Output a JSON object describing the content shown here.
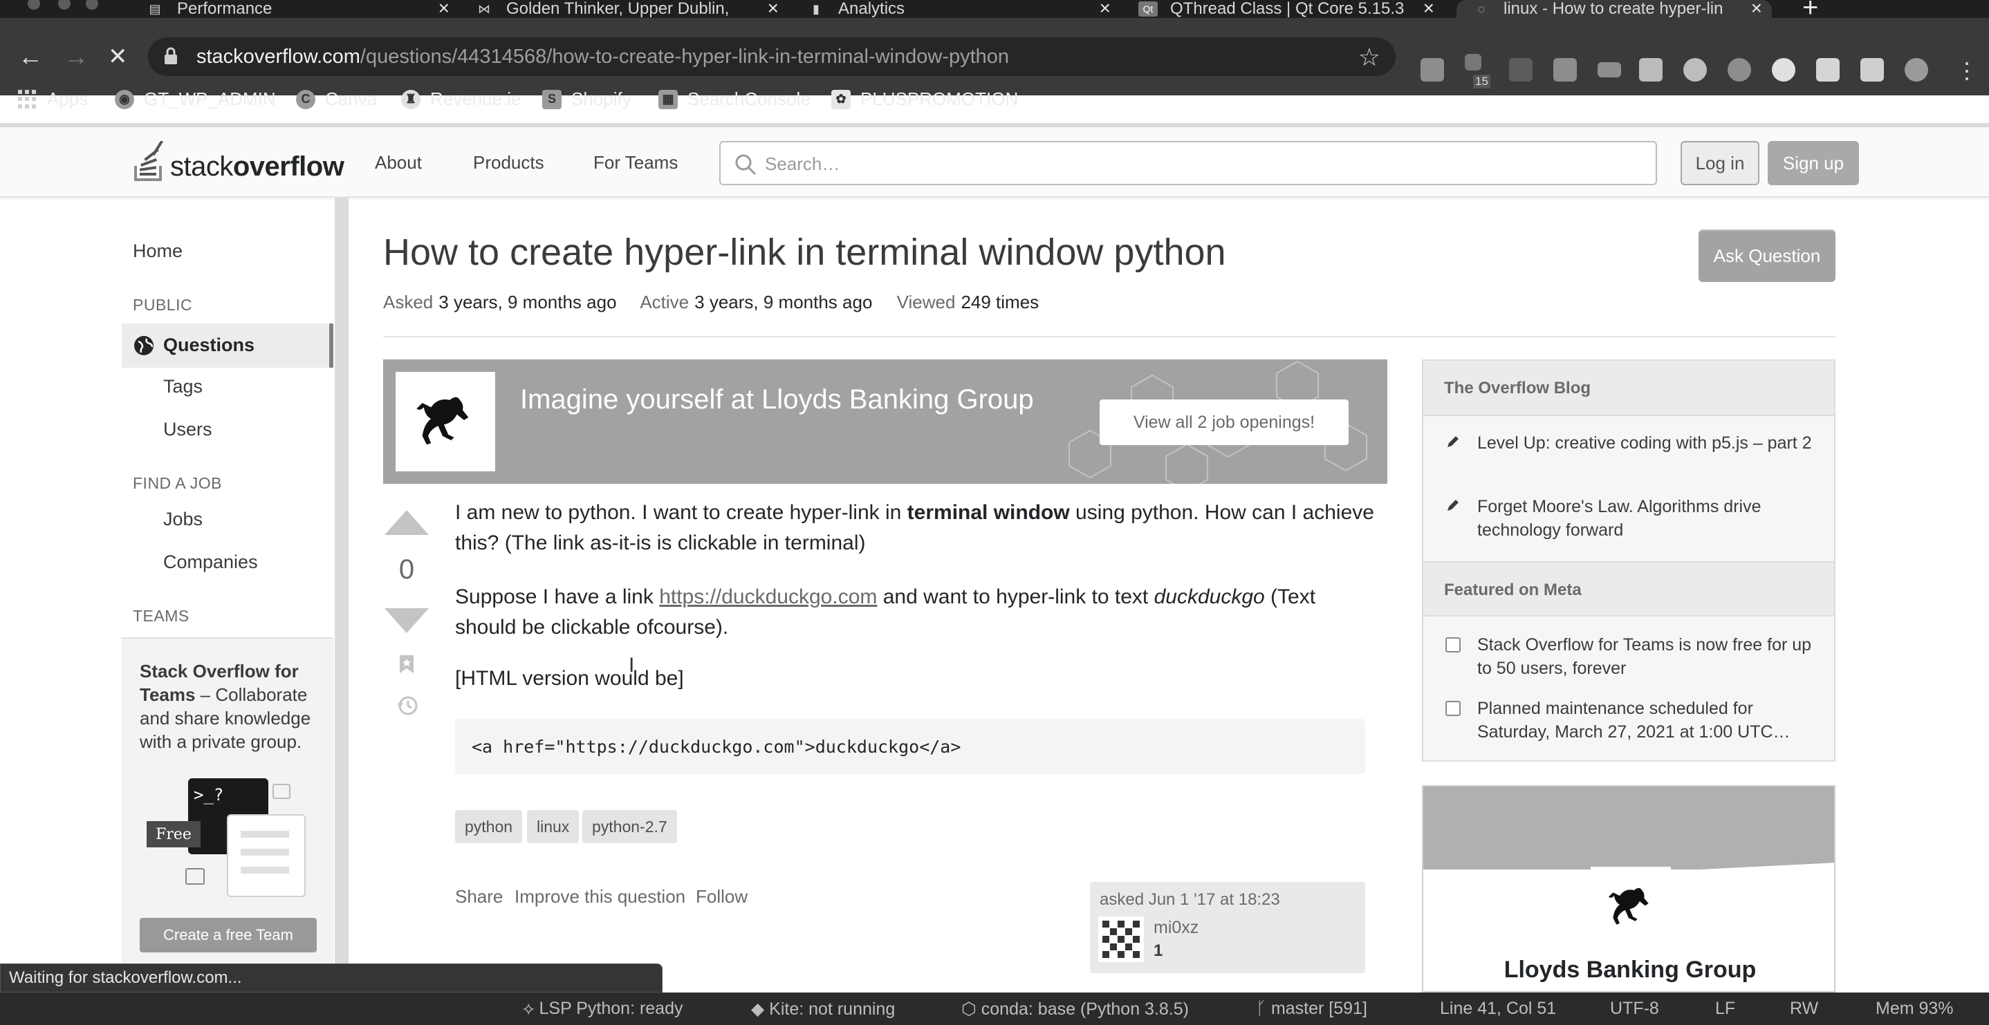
{
  "browser": {
    "tabs": [
      {
        "title": "Performance",
        "icon": "performance-icon",
        "active": false
      },
      {
        "title": "Golden Thinker, Upper Dublin,",
        "icon": "map-icon",
        "active": false
      },
      {
        "title": "Analytics",
        "icon": "analytics-icon",
        "active": false
      },
      {
        "title": "QThread Class | Qt Core 5.15.3",
        "icon": "qt-icon",
        "active": false
      },
      {
        "title": "linux - How to create hyper-lin",
        "icon": "loading-icon",
        "active": true
      }
    ],
    "new_tab": "+",
    "close_glyph": "×",
    "url_host": "stackoverflow.com",
    "url_path": "/questions/44314568/how-to-create-hyper-link-in-terminal-window-python",
    "extension_badge": "15",
    "bookmarks": [
      {
        "label": "Apps",
        "icon": "apps-grid-icon"
      },
      {
        "label": "GT_WP_ADMIN",
        "icon": "wp-icon"
      },
      {
        "label": "Canva",
        "icon": "canva-icon"
      },
      {
        "label": "Revenue.ie",
        "icon": "revenue-icon"
      },
      {
        "label": "Shopify",
        "icon": "shopify-icon"
      },
      {
        "label": "SearchConsole",
        "icon": "searchconsole-icon"
      },
      {
        "label": "PLUSPROMOTION",
        "icon": "plus-icon"
      }
    ]
  },
  "so_header": {
    "logo_light": "stack",
    "logo_bold": "overflow",
    "nav": [
      "About",
      "Products",
      "For Teams"
    ],
    "search_placeholder": "Search…",
    "login": "Log in",
    "signup": "Sign up"
  },
  "left_nav": {
    "home": "Home",
    "public_heading": "PUBLIC",
    "questions": "Questions",
    "tags": "Tags",
    "users": "Users",
    "find_job_heading": "FIND A JOB",
    "jobs": "Jobs",
    "companies": "Companies",
    "teams_heading": "TEAMS",
    "teams_title": "Stack Overflow for Teams",
    "teams_desc": " – Collaborate and share knowledge with a private group.",
    "teams_free": "Free",
    "teams_prompt": ">_?",
    "teams_button": "Create a free Team"
  },
  "question": {
    "title": "How to create hyper-link in terminal window python",
    "asked_label": "Asked",
    "asked_value": "3 years, 9 months ago",
    "active_label": "Active",
    "active_value": "3 years, 9 months ago",
    "viewed_label": "Viewed",
    "viewed_value": "249 times",
    "ask_button": "Ask Question",
    "votes": "0",
    "p1_a": "I am new to python. I want to create hyper-link in ",
    "p1_bold": "terminal window",
    "p1_b": " using python. How can I achieve this? (The link as-it-is is clickable in terminal)",
    "p2_a": "Suppose I have a link ",
    "p2_link": "https://duckduckgo.com",
    "p2_b": " and want to hyper-link to text ",
    "p2_em": "duckduckgo",
    "p2_c": " (Text should be clickable ofcourse).",
    "p3": "[HTML version would be]",
    "code": "<a href=\"https://duckduckgo.com\">duckduckgo</a>",
    "tags": [
      "python",
      "linux",
      "python-2.7"
    ],
    "share": "Share",
    "improve": "Improve this question",
    "follow": "Follow",
    "asked_on": "asked Jun 1 '17 at 18:23",
    "user": "mi0xz",
    "reputation": "1"
  },
  "job_banner": {
    "title": "Imagine yourself at Lloyds Banking Group",
    "button": "View all 2 job openings!"
  },
  "sidebar": {
    "blog_heading": "The Overflow Blog",
    "blog_items": [
      "Level Up: creative coding with p5.js – part 2",
      "Forget Moore's Law. Algorithms drive technology forward"
    ],
    "meta_heading": "Featured on Meta",
    "meta_items": [
      "Stack Overflow for Teams is now free for up to 50 users, forever",
      "Planned maintenance scheduled for Saturday, March 27, 2021 at 1:00 UTC…"
    ],
    "company_name": "Lloyds Banking Group"
  },
  "status": {
    "loading_text": "Waiting for stackoverflow.com...",
    "lsp": "LSP Python: ready",
    "kite": "Kite: not running",
    "conda": "conda: base (Python 3.8.5)",
    "git": "master [591]",
    "cursor": "Line 41, Col 51",
    "encoding": "UTF-8",
    "eol": "LF",
    "mode": "RW",
    "memory": "Mem 93%"
  }
}
